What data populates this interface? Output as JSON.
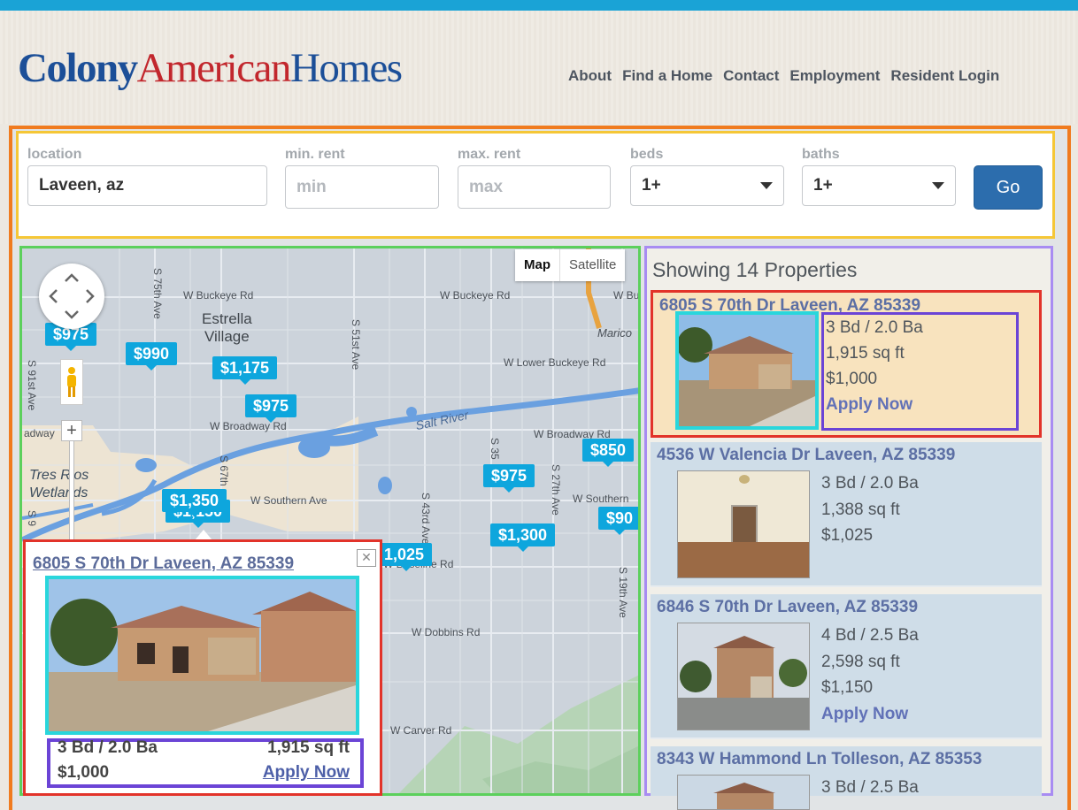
{
  "brand": {
    "part1": "Colony",
    "part2": "American",
    "part3": "Homes"
  },
  "nav": [
    "About",
    "Find a Home",
    "Contact",
    "Employment",
    "Resident Login"
  ],
  "search": {
    "location_label": "location",
    "location_value": "Laveen, az",
    "min_label": "min. rent",
    "min_placeholder": "min",
    "max_label": "max. rent",
    "max_placeholder": "max",
    "beds_label": "beds",
    "beds_value": "1+",
    "baths_label": "baths",
    "baths_value": "1+",
    "go_label": "Go"
  },
  "map": {
    "type_map": "Map",
    "type_satellite": "Satellite",
    "streets": {
      "buckeye_w": "W Buckeye Rd",
      "buckeye_e": "W Buckeye Rd",
      "bu_short": "W Bu",
      "lower_buckeye": "W Lower Buckeye Rd",
      "broadway_w": "W Broadway Rd",
      "broadway_e": "W Broadway Rd",
      "broadway_left": "adway",
      "southern_w": "W Southern Ave",
      "southern_e": "W Southern",
      "baseline": "W Baseline Rd",
      "dobbins": "W Dobbins Rd",
      "carver": "W Carver Rd",
      "ave75": "S 75th Ave",
      "ave91": "S 91st Ave",
      "ave51": "S 51st Ave",
      "ave67": "S 67th",
      "ave43": "S 43rd Ave",
      "ave35": "S 35",
      "ave27": "S 27th Ave",
      "ave19": "S 19th Ave",
      "ave91b": "S 9",
      "marico": "Marico",
      "salt_river": "Salt River"
    },
    "places": {
      "estrella": "Estrella\nVillage",
      "tres_rios": "Tres Rios\nWetlands"
    },
    "prices": [
      {
        "id": "p1",
        "label": "$975"
      },
      {
        "id": "p2",
        "label": "$990"
      },
      {
        "id": "p3",
        "label": "$1,175"
      },
      {
        "id": "p4",
        "label": "$975"
      },
      {
        "id": "p5",
        "label": "$850"
      },
      {
        "id": "p6",
        "label": "$975"
      },
      {
        "id": "p7",
        "label": "$1,350"
      },
      {
        "id": "p8",
        "label": "$1,150"
      },
      {
        "id": "p9",
        "label": "$90"
      },
      {
        "id": "p10",
        "label": "$1,300"
      },
      {
        "id": "p11",
        "label": "1,025"
      }
    ],
    "popup": {
      "title": "6805 S 70th Dr Laveen, AZ 85339",
      "close": "✕",
      "beds_baths": "3 Bd / 2.0 Ba",
      "sqft": "1,915 sq ft",
      "price": "$1,000",
      "apply": "Apply Now"
    }
  },
  "list": {
    "heading": "Showing 14 Properties",
    "items": [
      {
        "address": "6805 S 70th Dr Laveen, AZ 85339",
        "beds_baths": "3 Bd / 2.0 Ba",
        "sqft": "1,915 sq ft",
        "price": "$1,000",
        "apply": "Apply Now"
      },
      {
        "address": "4536 W Valencia Dr Laveen, AZ 85339",
        "beds_baths": "3 Bd / 2.0 Ba",
        "sqft": "1,388 sq ft",
        "price": "$1,025",
        "apply": ""
      },
      {
        "address": "6846 S 70th Dr Laveen, AZ 85339",
        "beds_baths": "4 Bd / 2.5 Ba",
        "sqft": "2,598 sq ft",
        "price": "$1,150",
        "apply": "Apply Now"
      },
      {
        "address": "8343 W Hammond Ln Tolleson, AZ 85353",
        "beds_baths": "3 Bd / 2.5 Ba",
        "sqft": "",
        "price": "",
        "apply": ""
      }
    ]
  }
}
